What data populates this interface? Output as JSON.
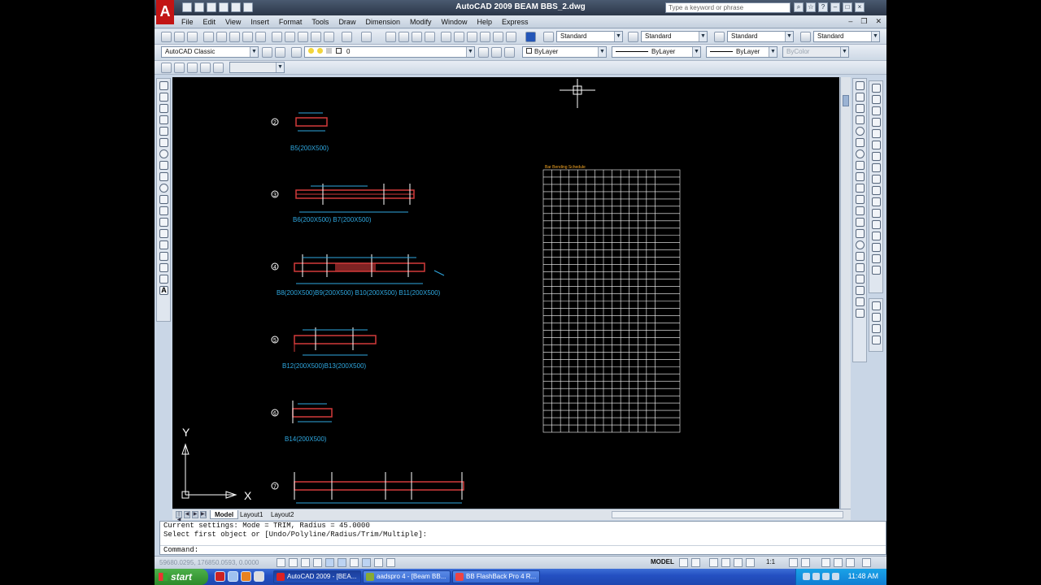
{
  "window": {
    "title": "AutoCAD 2009  BEAM BBS_2.dwg",
    "logo": "A",
    "search_placeholder": "Type a keyword or phrase"
  },
  "menu": [
    "File",
    "Edit",
    "View",
    "Insert",
    "Format",
    "Tools",
    "Draw",
    "Dimension",
    "Modify",
    "Window",
    "Help",
    "Express"
  ],
  "toolbar": {
    "text_style": "Standard",
    "dim_style": "Standard",
    "table_style": "Standard",
    "mleader_style": "Standard",
    "workspace": "AutoCAD Classic",
    "layer": "0",
    "color": "ByLayer",
    "linetype": "ByLayer",
    "lineweight": "ByLayer",
    "plotstyle": "ByColor"
  },
  "drawing": {
    "items": [
      {
        "num": "2",
        "label": "B5(200X500)"
      },
      {
        "num": "3",
        "label": "B6(200X500)       B7(200X500)"
      },
      {
        "num": "4",
        "label": "B8(200X500)B9(200X500)  B10(200X500)  B11(200X500)"
      },
      {
        "num": "5",
        "label": "B12(200X500)B13(200X500)"
      },
      {
        "num": "6",
        "label": "B14(200X500)"
      },
      {
        "num": "7",
        "label": ""
      }
    ],
    "schedule_title": "Bar Bending Schedule",
    "ucs_x": "X",
    "ucs_y": "Y"
  },
  "tabs": [
    "Model",
    "Layout1",
    "Layout2"
  ],
  "command": {
    "line1": "Current settings: Mode = TRIM, Radius = 45.0000",
    "line2": "Select first object or [Undo/Polyline/Radius/Trim/Multiple]:",
    "prompt": "Command:"
  },
  "status": {
    "coords": "59680.0295, 176850.0593, 0.0000",
    "model": "MODEL",
    "scale": "1:1"
  },
  "taskbar": {
    "start": "start",
    "tasks": [
      "AutoCAD 2009 - [BEA...",
      "aadspro 4 - [Beam BB...",
      "BB FlashBack Pro 4 R..."
    ],
    "clock": "11:48 AM"
  },
  "colors": {
    "drawing_bg": "#000000",
    "beam": "#d23a3a",
    "dim": "#2fa8e0",
    "schedule": "#ffffff"
  }
}
